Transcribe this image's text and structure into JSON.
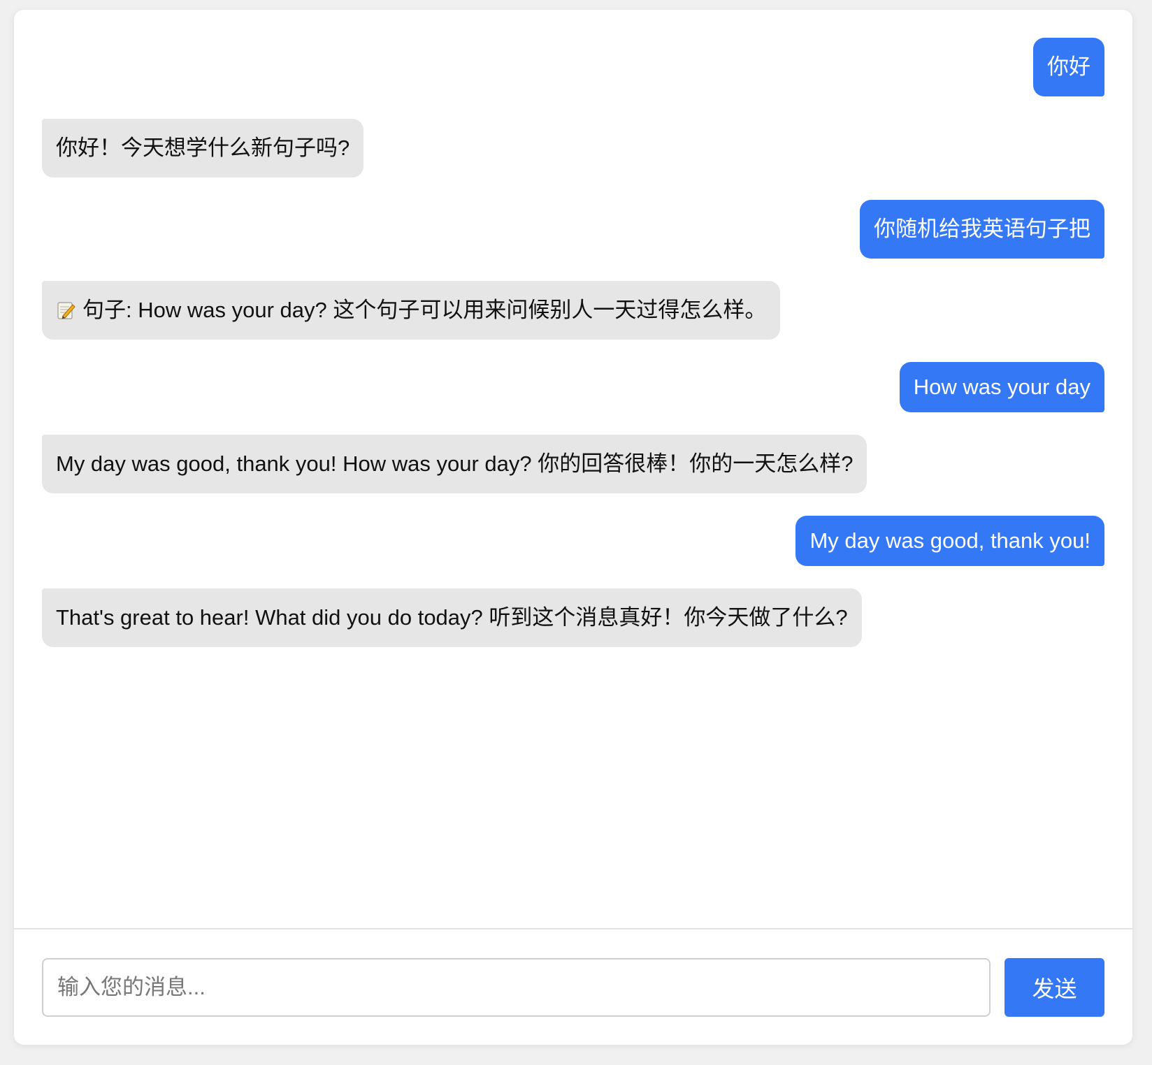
{
  "chat": {
    "messages": [
      {
        "role": "user",
        "text": "你好"
      },
      {
        "role": "assistant",
        "text": "你好！今天想学什么新句子吗?"
      },
      {
        "role": "user",
        "text": "你随机给我英语句子把"
      },
      {
        "role": "assistant",
        "icon": "memo-icon",
        "text": "句子: How was your day? 这个句子可以用来问候别人一天过得怎么样。"
      },
      {
        "role": "user",
        "text": "How was your day"
      },
      {
        "role": "assistant",
        "text": "My day was good, thank you! How was your day? 你的回答很棒！你的一天怎么样?"
      },
      {
        "role": "user",
        "text": "My day was good, thank you!"
      },
      {
        "role": "assistant",
        "text": "That's great to hear! What did you do today? 听到这个消息真好！你今天做了什么?"
      }
    ]
  },
  "composer": {
    "placeholder": "输入您的消息...",
    "value": "",
    "send_label": "发送"
  },
  "colors": {
    "user_bubble": "#3478f6",
    "assistant_bubble": "#e6e6e6",
    "send_button": "#3478f6"
  }
}
